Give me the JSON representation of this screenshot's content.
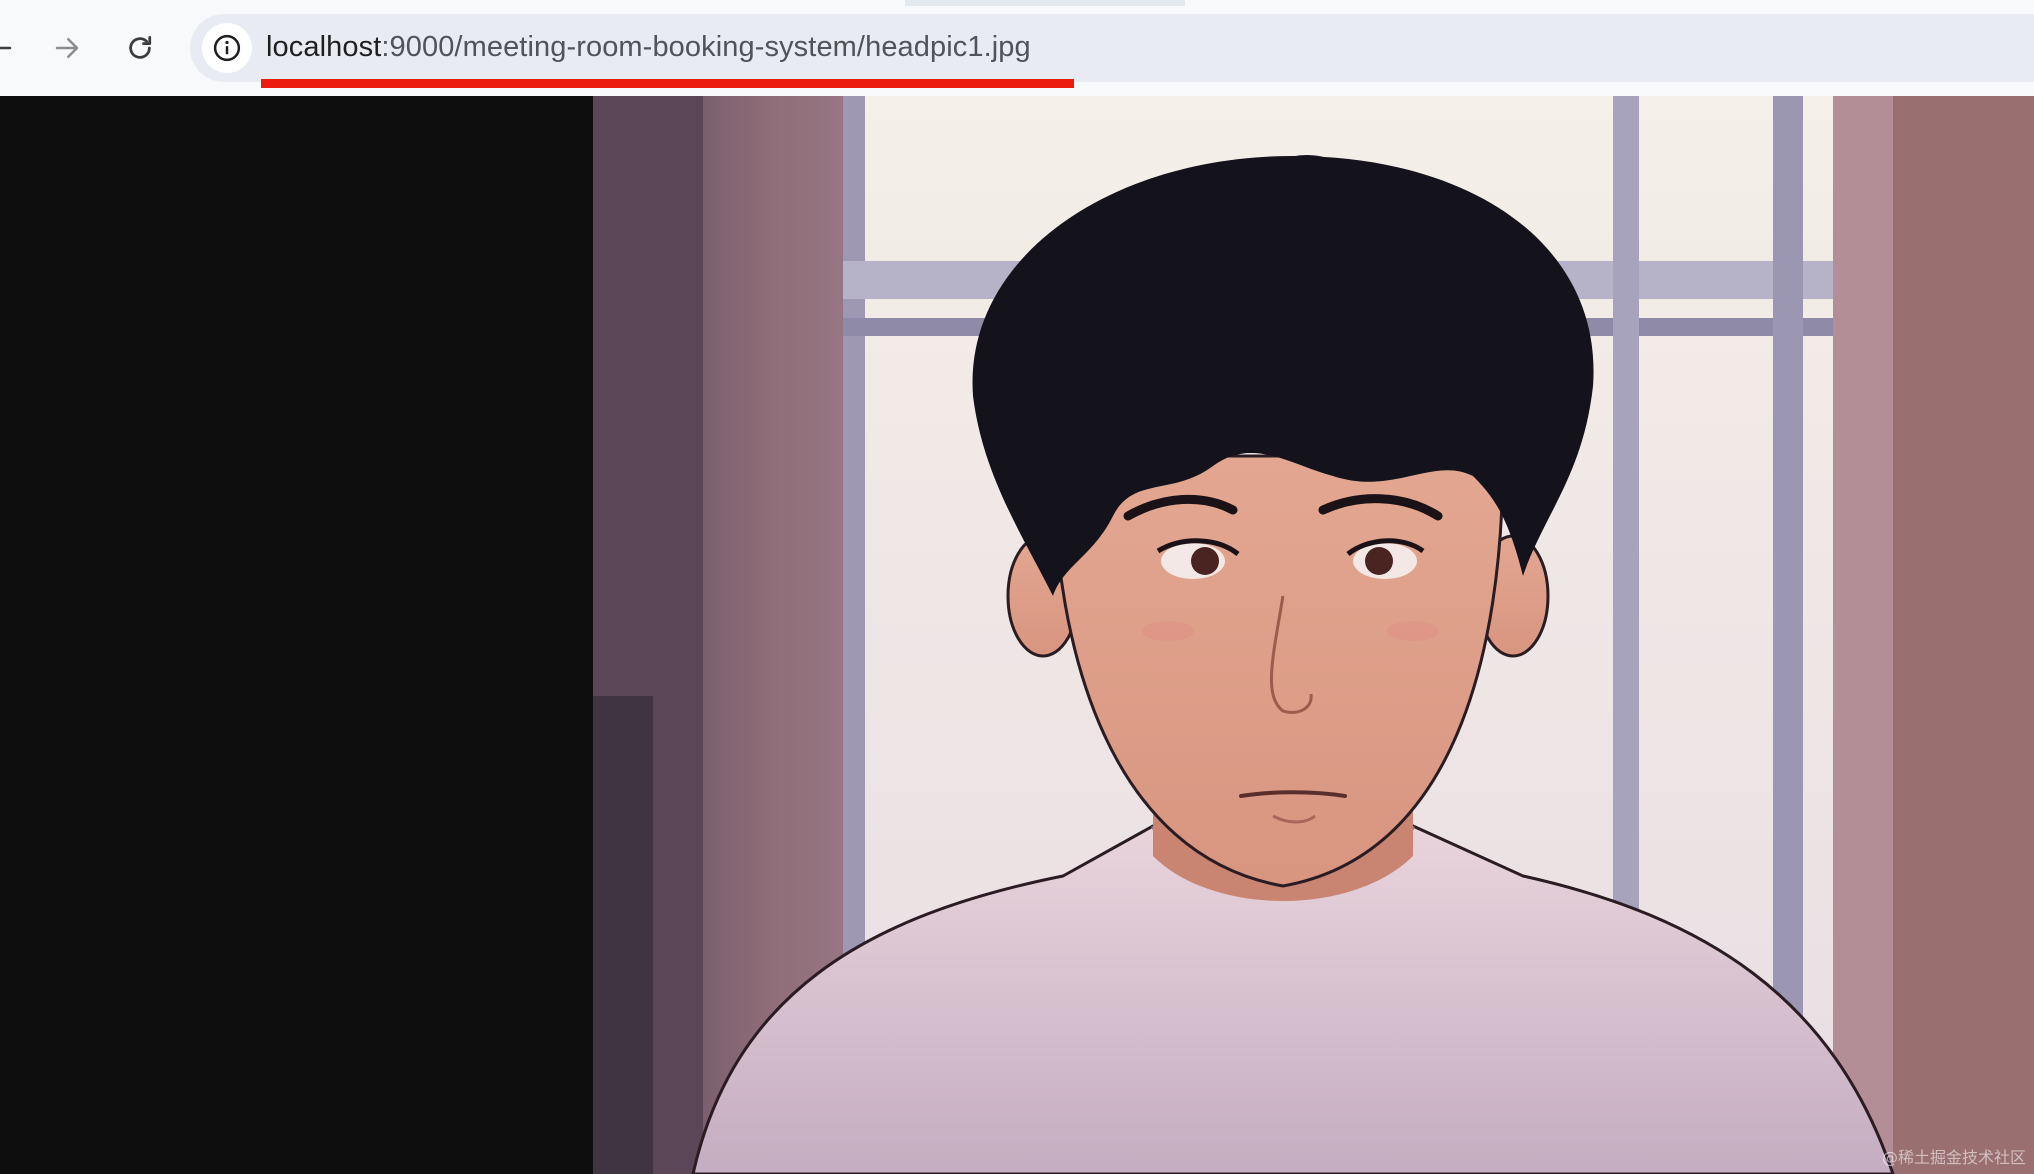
{
  "toolbar": {
    "back_icon": "arrow-left-icon",
    "forward_icon": "arrow-right-icon",
    "reload_icon": "reload-icon",
    "site_info_icon": "info-icon"
  },
  "address_bar": {
    "url_host": "localhost",
    "url_path": ":9000/meeting-room-booking-system/headpic1.jpg",
    "highlight_color": "#ec1c0f"
  },
  "viewer": {
    "background": "#0e0e0f",
    "watermark": "@稀土掘金技术社区"
  }
}
